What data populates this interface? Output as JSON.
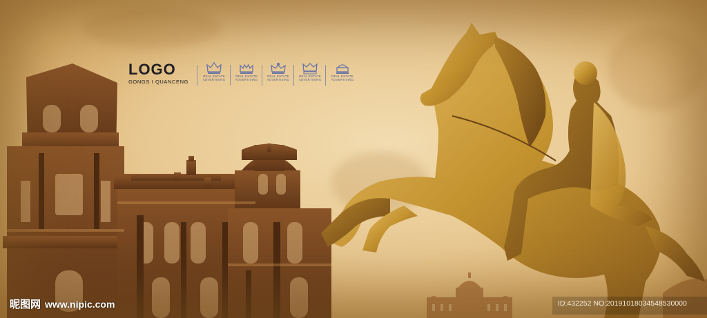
{
  "logo": {
    "title": "LOGO",
    "subtitle": "GONGS I QUANCENG"
  },
  "crown_badges": [
    {
      "icon": "crown-icon",
      "line1": "REAL ESTATE",
      "line2": "ADVERTISING"
    },
    {
      "icon": "crown-icon",
      "line1": "REAL ESTATE",
      "line2": "ADVERTISING"
    },
    {
      "icon": "crown-icon",
      "line1": "REAL ESTATE",
      "line2": "ADVERTISING"
    },
    {
      "icon": "crown-icon",
      "line1": "REAL ESTATE",
      "line2": "ADVERTISING"
    },
    {
      "icon": "crown-icon",
      "line1": "REAL ESTATE",
      "line2": "ADVERTISING"
    }
  ],
  "watermark": {
    "brand": "昵图网",
    "site": "www.nipic.com",
    "id_text": "ID:432252 NO:20191018034548530000"
  },
  "colors": {
    "paper_light": "#f2dcb0",
    "paper_dark": "#b48347",
    "statue_gold": "#c9962f",
    "building_brown": "#7a4a22",
    "logo_text": "#1f1f24",
    "badge_blue": "#6a74a8"
  }
}
